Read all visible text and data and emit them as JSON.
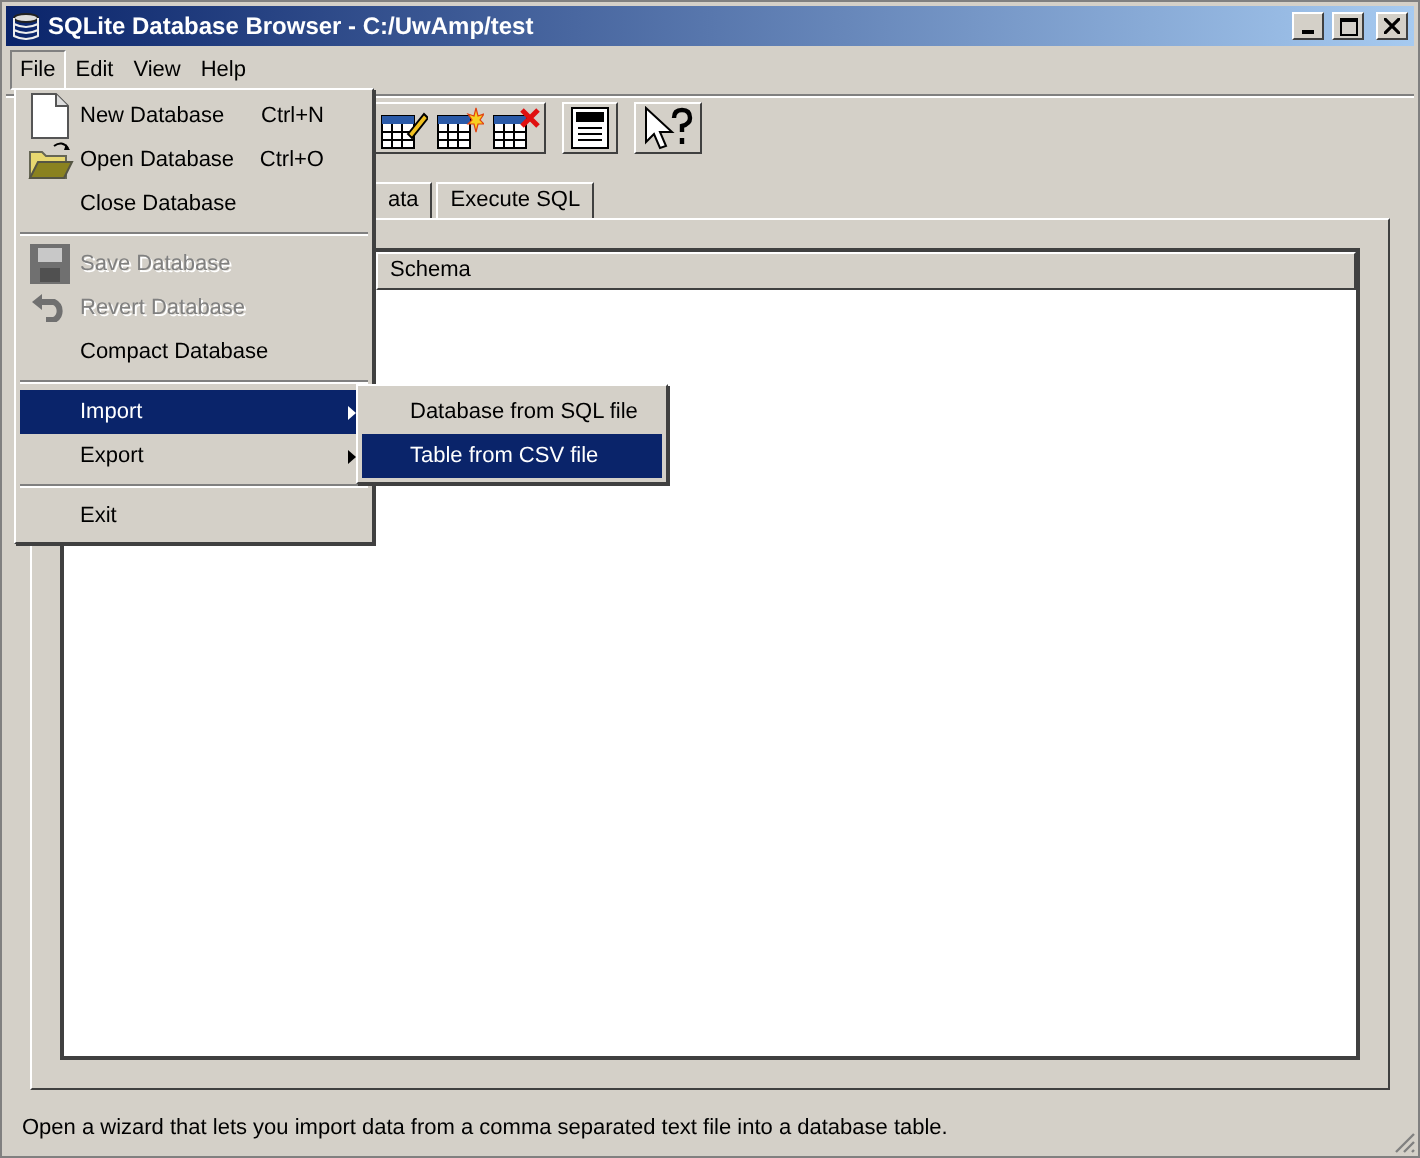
{
  "window": {
    "title": "SQLite Database Browser - C:/UwAmp/test"
  },
  "menu_bar": [
    {
      "label": "File",
      "selected": true
    },
    {
      "label": "Edit",
      "selected": false
    },
    {
      "label": "View",
      "selected": false
    },
    {
      "label": "Help",
      "selected": false
    }
  ],
  "tabs": [
    {
      "label": "ata",
      "selected": false
    },
    {
      "label": "Execute SQL",
      "selected": false
    }
  ],
  "table": {
    "columns": [
      "Schema"
    ]
  },
  "file_menu": [
    {
      "kind": "item",
      "label": "New Database",
      "shortcut": "Ctrl+N",
      "disabled": false,
      "selected": false,
      "submenu": false
    },
    {
      "kind": "item",
      "label": "Open Database",
      "shortcut": "Ctrl+O",
      "disabled": false,
      "selected": false,
      "submenu": false
    },
    {
      "kind": "item",
      "label": "Close Database",
      "disabled": false,
      "selected": false,
      "submenu": false
    },
    {
      "kind": "separator"
    },
    {
      "kind": "item",
      "label": "Save Database",
      "disabled": true,
      "selected": false,
      "submenu": false
    },
    {
      "kind": "item",
      "label": "Revert Database",
      "disabled": true,
      "selected": false,
      "submenu": false
    },
    {
      "kind": "item",
      "label": "Compact Database",
      "disabled": false,
      "selected": false,
      "submenu": false
    },
    {
      "kind": "separator"
    },
    {
      "kind": "item",
      "label": "Import",
      "disabled": false,
      "selected": true,
      "submenu": true
    },
    {
      "kind": "item",
      "label": "Export",
      "disabled": false,
      "selected": false,
      "submenu": true
    },
    {
      "kind": "separator"
    },
    {
      "kind": "item",
      "label": "Exit",
      "disabled": false,
      "selected": false,
      "submenu": false
    }
  ],
  "import_submenu": [
    {
      "label": "Database from SQL file",
      "selected": false
    },
    {
      "label": "Table from CSV file",
      "selected": true
    }
  ],
  "status_bar": "Open a wizard that lets you import data from a comma separated text file into a database table."
}
